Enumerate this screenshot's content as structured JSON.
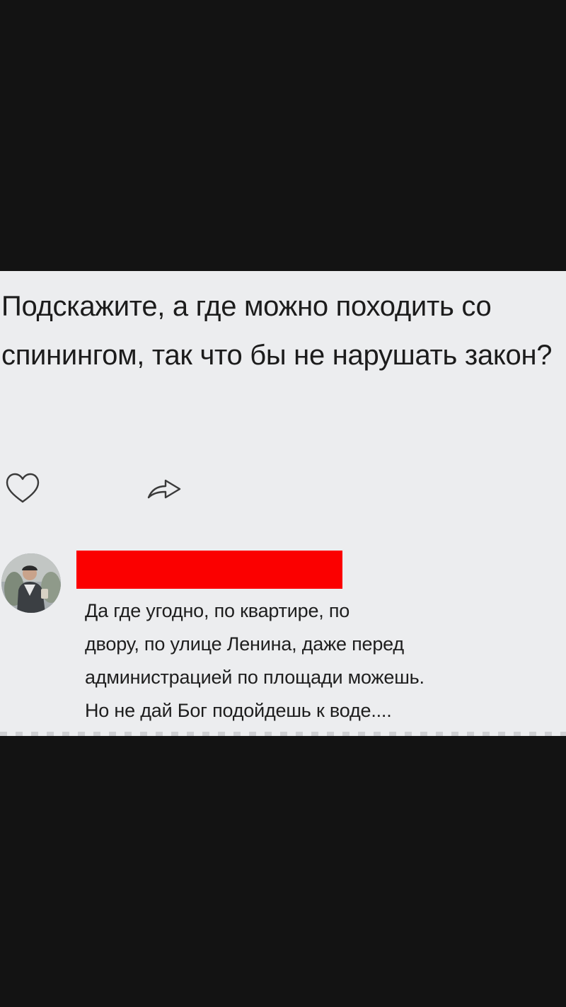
{
  "post": {
    "question": "Подскажите, а где можно походить со спинингом, так что бы не нарушать закон?"
  },
  "actions": {
    "like_icon": "heart-outline-icon",
    "share_icon": "share-arrow-icon"
  },
  "comment": {
    "author_redacted_color": "#fb0000",
    "avatar_icon": "user-avatar-photo",
    "text": "Да где угодно, по квартире, по\nдвору, по улице Ленина, даже перед\nадминистрацией по площади можешь.\nНо не дай Бог подойдешь к воде...."
  },
  "colors": {
    "background": "#131313",
    "card": "#ecedef",
    "text": "#1c1c1c"
  }
}
